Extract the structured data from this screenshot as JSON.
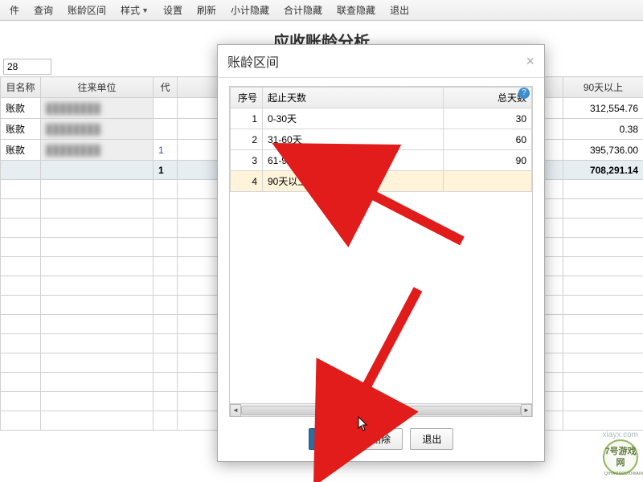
{
  "toolbar": {
    "file": "件",
    "query": "查询",
    "aging_range": "账龄区间",
    "style": "样式",
    "settings": "设置",
    "refresh": "刷新",
    "subtotal_hide": "小计隐藏",
    "total_hide": "合计隐藏",
    "linked_hide": "联查隐藏",
    "exit": "退出"
  },
  "page_title": "应收账龄分析",
  "input_value": "28",
  "main_headers": {
    "subject_name": "目名称",
    "partner_unit": "往来单位",
    "mid": "代",
    "over_90": "90天以上"
  },
  "main_rows": [
    {
      "subject": "账款",
      "over90": "312,554.76"
    },
    {
      "subject": "账款",
      "over90": "0.38"
    },
    {
      "subject": "账款",
      "over90": "395,736.00"
    }
  ],
  "main_total_row": {
    "over90": "708,291.14",
    "mid": "1"
  },
  "modal": {
    "title": "账龄区间",
    "headers": {
      "seq": "序号",
      "range": "起止天数",
      "total_days": "总天数"
    },
    "rows": [
      {
        "seq": "1",
        "range": "0-30天",
        "days": "30"
      },
      {
        "seq": "2",
        "range": "31-60天",
        "days": "60"
      },
      {
        "seq": "3",
        "range": "61-90天",
        "days": "90"
      },
      {
        "seq": "4",
        "range": "90天以上!",
        "days": ""
      }
    ],
    "buttons": {
      "add": "增加",
      "delete": "删除",
      "exit": "退出"
    }
  },
  "watermark": {
    "brand": "7号游戏网",
    "sub": "QIHAOYOUXIWANG",
    "url": "xiayx.com"
  }
}
